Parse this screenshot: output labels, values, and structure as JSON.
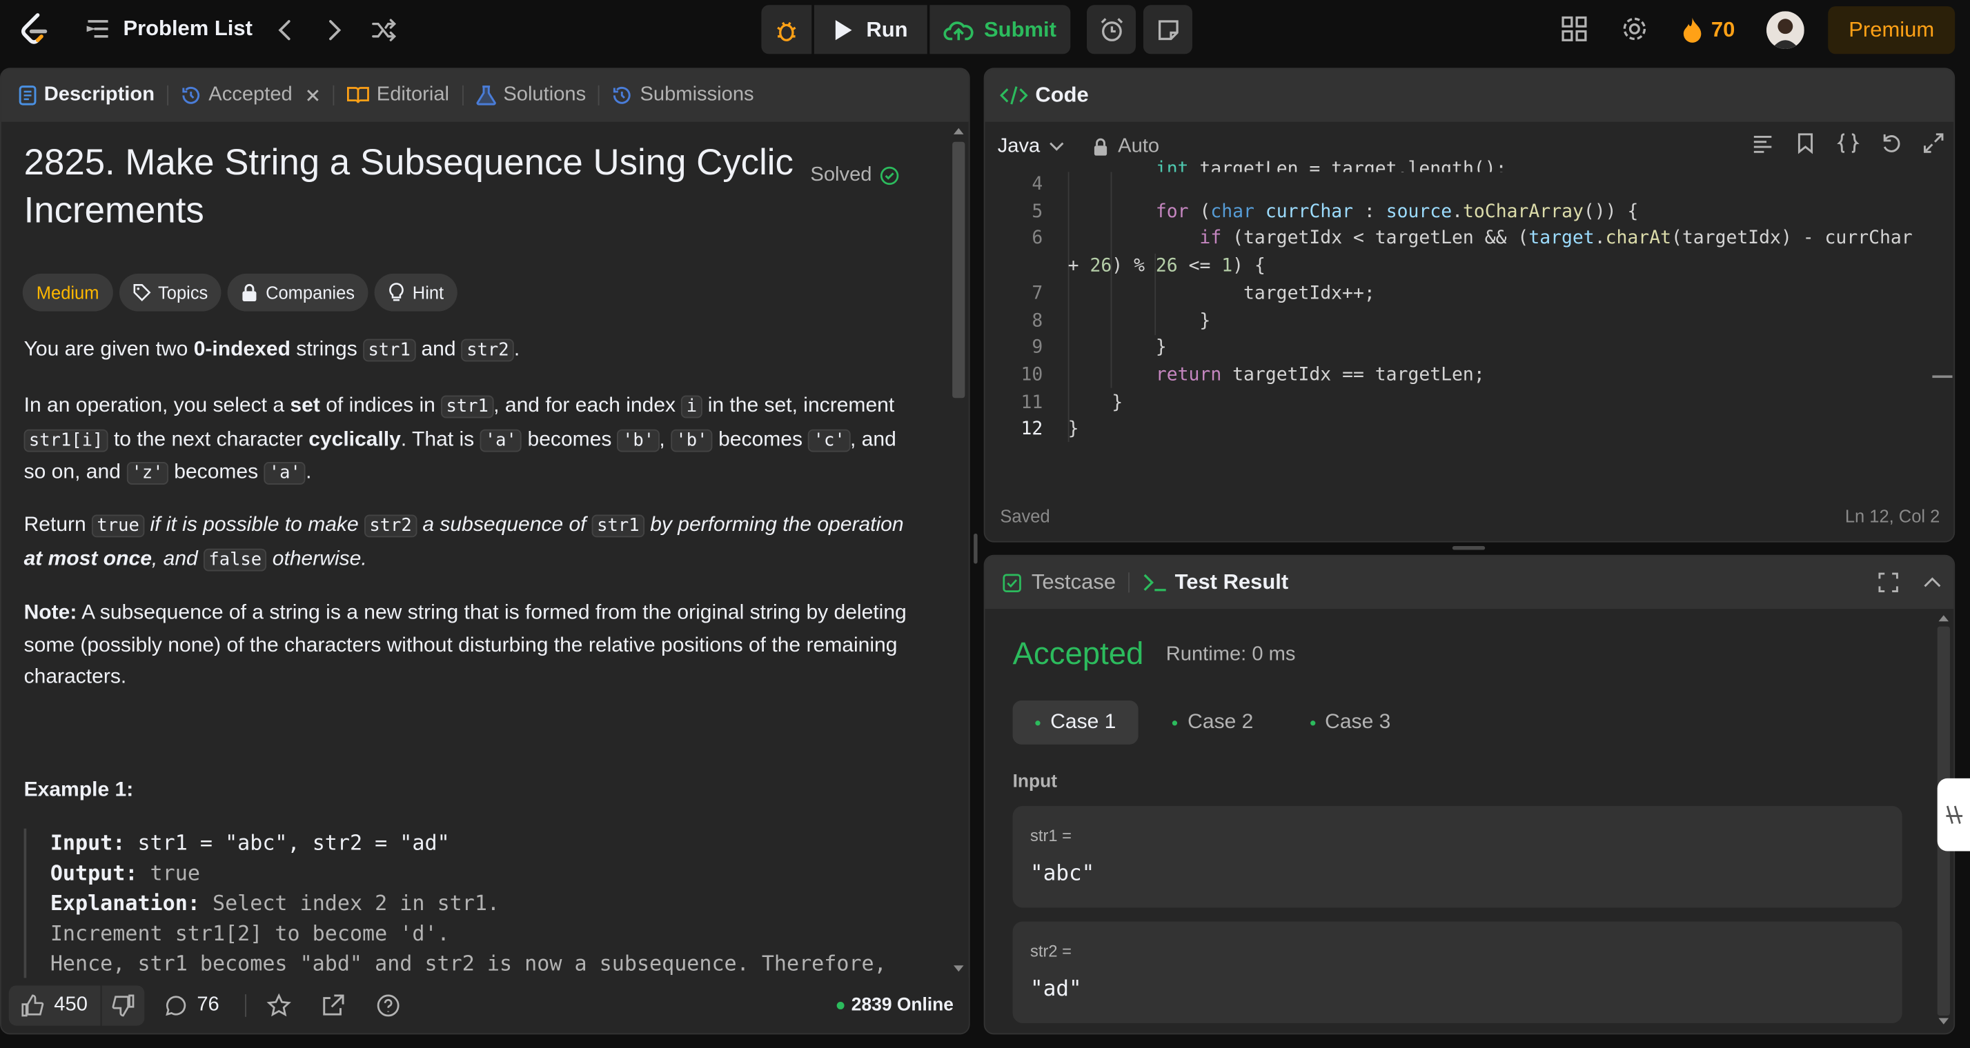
{
  "topbar": {
    "problem_list": "Problem List",
    "run": "Run",
    "submit": "Submit",
    "streak": "70",
    "premium": "Premium"
  },
  "left": {
    "tabs": [
      "Description",
      "Accepted",
      "Editorial",
      "Solutions",
      "Submissions"
    ],
    "title": "2825. Make String a Subsequence Using Cyclic Increments",
    "solved": "Solved",
    "chips": [
      "Medium",
      "Topics",
      "Companies",
      "Hint"
    ],
    "example_title": "Example 1:",
    "likes": "450",
    "comments": "76",
    "online": "2839 Online"
  },
  "code": {
    "header": "Code",
    "language": "Java",
    "mode": "Auto",
    "saved": "Saved",
    "position": "Ln 12, Col 2",
    "line_numbers": [
      "4",
      "5",
      "6",
      "7",
      "8",
      "9",
      "10",
      "11",
      "12"
    ]
  },
  "test": {
    "tab_testcase": "Testcase",
    "tab_result": "Test Result",
    "status": "Accepted",
    "runtime": "Runtime: 0 ms",
    "cases": [
      "Case 1",
      "Case 2",
      "Case 3"
    ],
    "input_label": "Input",
    "inputs": [
      {
        "name": "str1 =",
        "value": "\"abc\""
      },
      {
        "name": "str2 =",
        "value": "\"ad\""
      }
    ]
  }
}
